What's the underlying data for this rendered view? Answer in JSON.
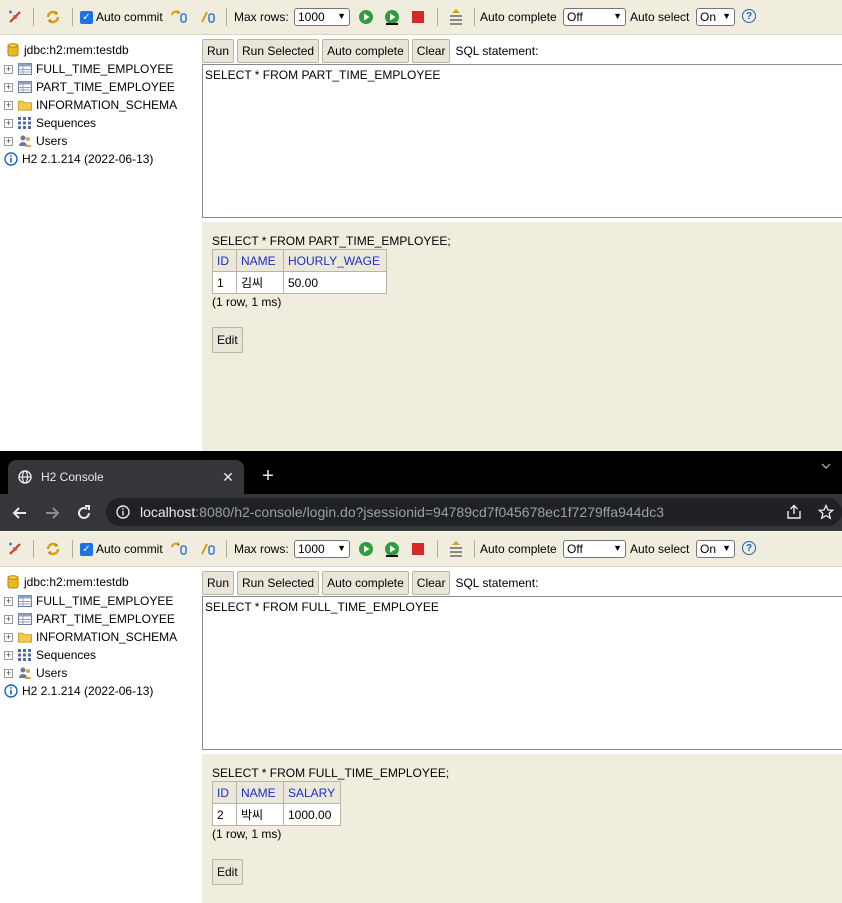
{
  "toolbar": {
    "auto_commit_label": "Auto commit",
    "max_rows_label": "Max rows:",
    "max_rows_value": "1000",
    "auto_complete_label": "Auto complete",
    "auto_complete_value": "Off",
    "auto_select_label": "Auto select",
    "auto_select_value": "On",
    "help_glyph": "?"
  },
  "tree": {
    "connection": "jdbc:h2:mem:testdb",
    "items": [
      {
        "label": "FULL_TIME_EMPLOYEE",
        "icon": "table-icon"
      },
      {
        "label": "PART_TIME_EMPLOYEE",
        "icon": "table-icon"
      },
      {
        "label": "INFORMATION_SCHEMA",
        "icon": "folder-icon"
      },
      {
        "label": "Sequences",
        "icon": "sequences-icon"
      },
      {
        "label": "Users",
        "icon": "users-icon"
      }
    ],
    "version": "H2 2.1.214 (2022-06-13)"
  },
  "sql_toolbar": {
    "run": "Run",
    "run_selected": "Run Selected",
    "auto_complete": "Auto complete",
    "clear": "Clear",
    "sql_statement_label": "SQL statement:"
  },
  "top_pane": {
    "sql_input": "SELECT * FROM PART_TIME_EMPLOYEE",
    "result_sql": "SELECT * FROM PART_TIME_EMPLOYEE;",
    "columns": [
      "ID",
      "NAME",
      "HOURLY_WAGE"
    ],
    "rows": [
      [
        "1",
        "김씨",
        "50.00"
      ]
    ],
    "status": "(1 row, 1 ms)",
    "edit": "Edit"
  },
  "browser": {
    "tab_title": "H2 Console",
    "tab_close_glyph": "✕",
    "new_tab_glyph": "+",
    "url_host": "localhost",
    "url_rest": ":8080/h2-console/login.do?jsessionid=94789cd7f045678ec1f7279ffa944dc3"
  },
  "bottom_pane": {
    "sql_input": "SELECT * FROM FULL_TIME_EMPLOYEE",
    "result_sql": "SELECT * FROM FULL_TIME_EMPLOYEE;",
    "columns": [
      "ID",
      "NAME",
      "SALARY"
    ],
    "rows": [
      [
        "2",
        "박씨",
        "1000.00"
      ]
    ],
    "status": "(1 row, 1 ms)",
    "edit": "Edit"
  },
  "colors": {
    "toolbar_bg": "#f0edde",
    "result_bg": "#f0edde",
    "header_text": "#1b2fc2",
    "chrome_bg": "#202124"
  }
}
